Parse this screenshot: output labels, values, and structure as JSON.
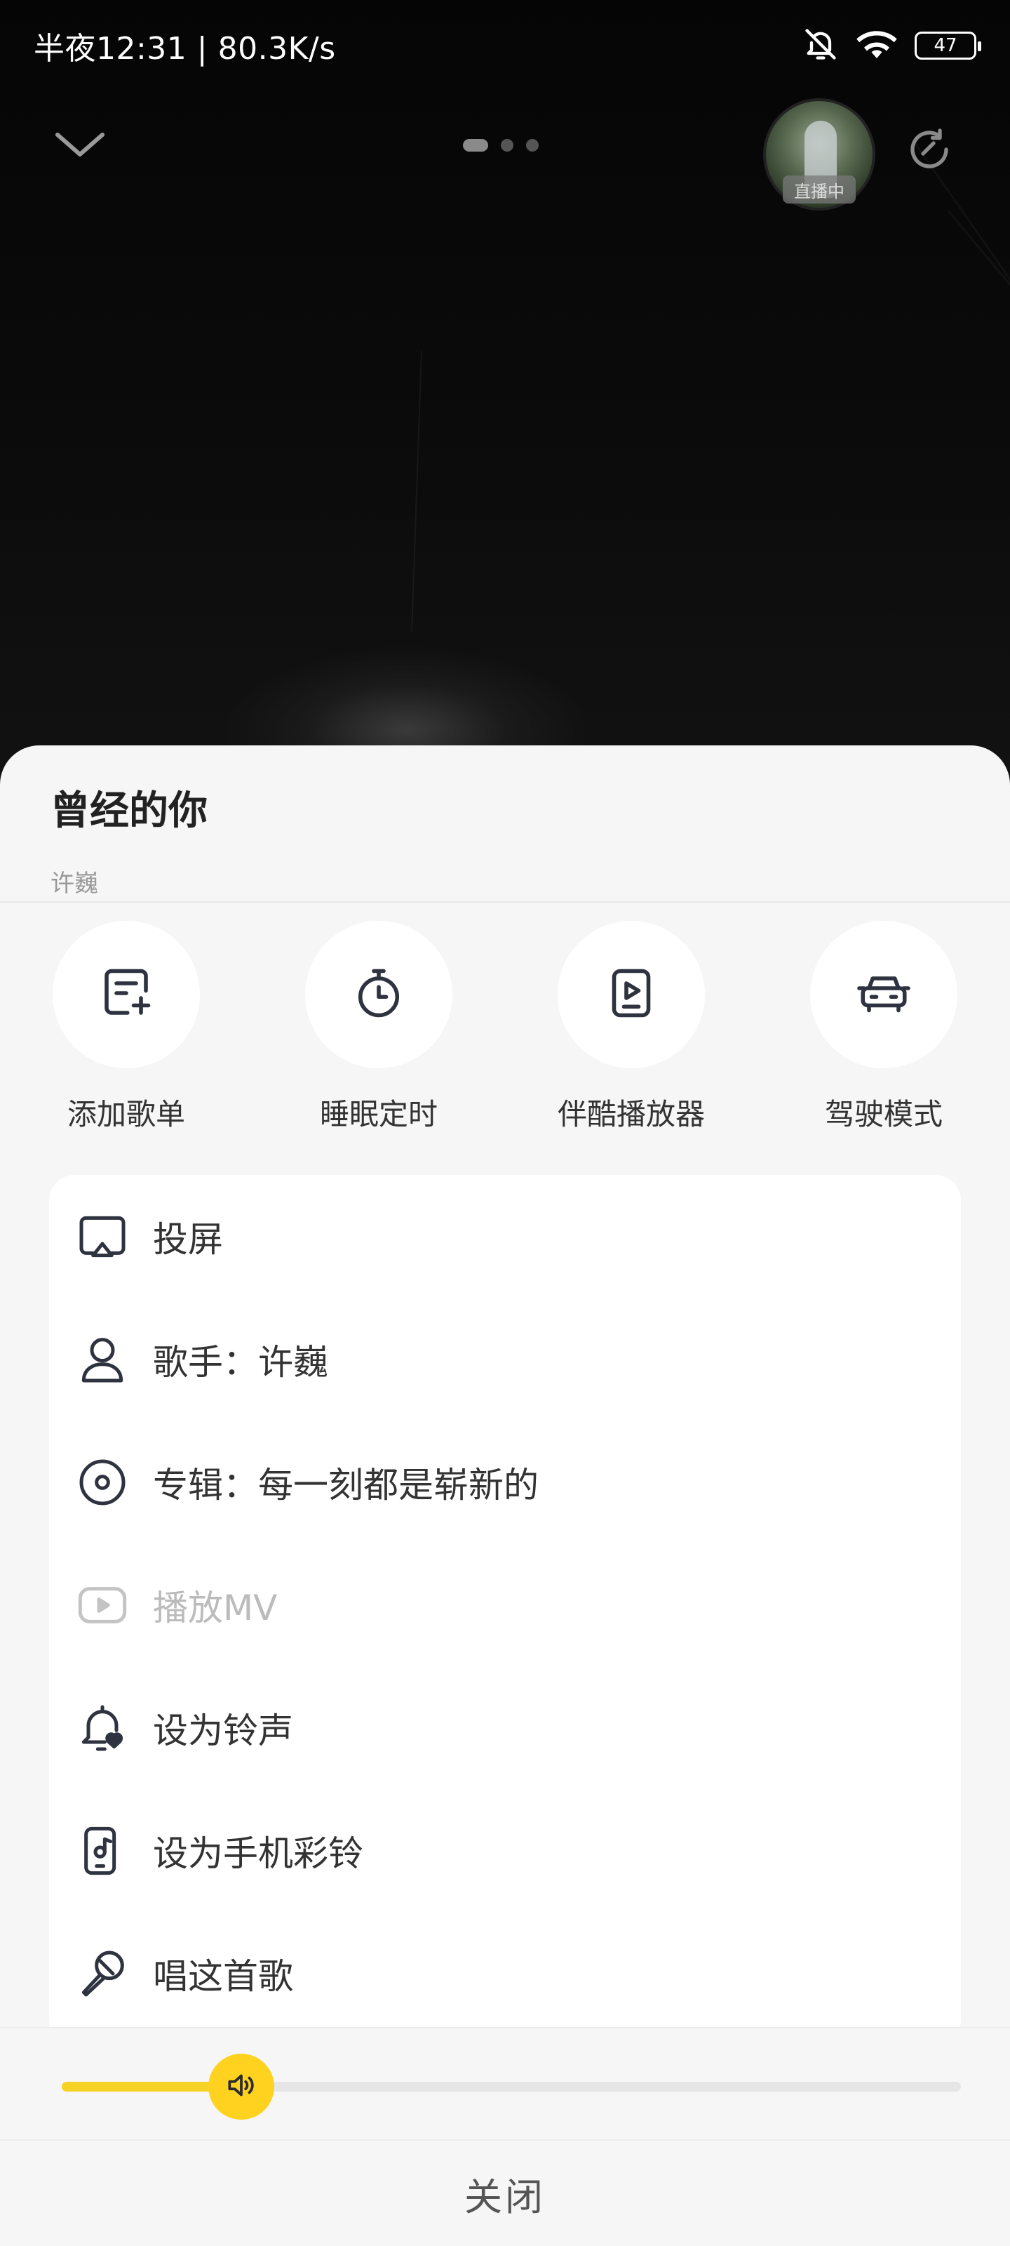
{
  "status_bar": {
    "time_speed": "半夜12:31 | 80.3K/s",
    "battery": "47",
    "icons": [
      "bell-muted-icon",
      "wifi-icon",
      "battery-icon"
    ]
  },
  "top_nav": {
    "page_count": 3,
    "active_page": 1,
    "live_badge": "直播中",
    "icons": [
      "chevron-down-icon",
      "refresh-icon"
    ]
  },
  "song": {
    "title": "曾经的你",
    "artist": "许巍"
  },
  "quick_actions": [
    {
      "label": "添加歌单",
      "icon": "add-playlist-icon"
    },
    {
      "label": "睡眠定时",
      "icon": "timer-icon"
    },
    {
      "label": "伴酷播放器",
      "icon": "player-icon"
    },
    {
      "label": "驾驶模式",
      "icon": "car-icon"
    }
  ],
  "menu": [
    {
      "label": "投屏",
      "icon": "cast-icon",
      "enabled": true
    },
    {
      "label": "歌手：许巍",
      "icon": "singer-icon",
      "enabled": true
    },
    {
      "label": "专辑：每一刻都是崭新的",
      "icon": "album-icon",
      "enabled": true
    },
    {
      "label": "播放MV",
      "icon": "play-mv-icon",
      "enabled": false
    },
    {
      "label": "设为铃声",
      "icon": "ringtone-icon",
      "enabled": true
    },
    {
      "label": "设为手机彩铃",
      "icon": "phone-ringback-icon",
      "enabled": true
    },
    {
      "label": "唱这首歌",
      "icon": "microphone-icon",
      "enabled": true
    }
  ],
  "volume": {
    "level": 0.2,
    "icon": "speaker-icon"
  },
  "close_label": "关闭",
  "colors": {
    "accent": "#ffd21f",
    "sheet_bg": "#f6f6f6",
    "icon_stroke": "#2f3340"
  }
}
